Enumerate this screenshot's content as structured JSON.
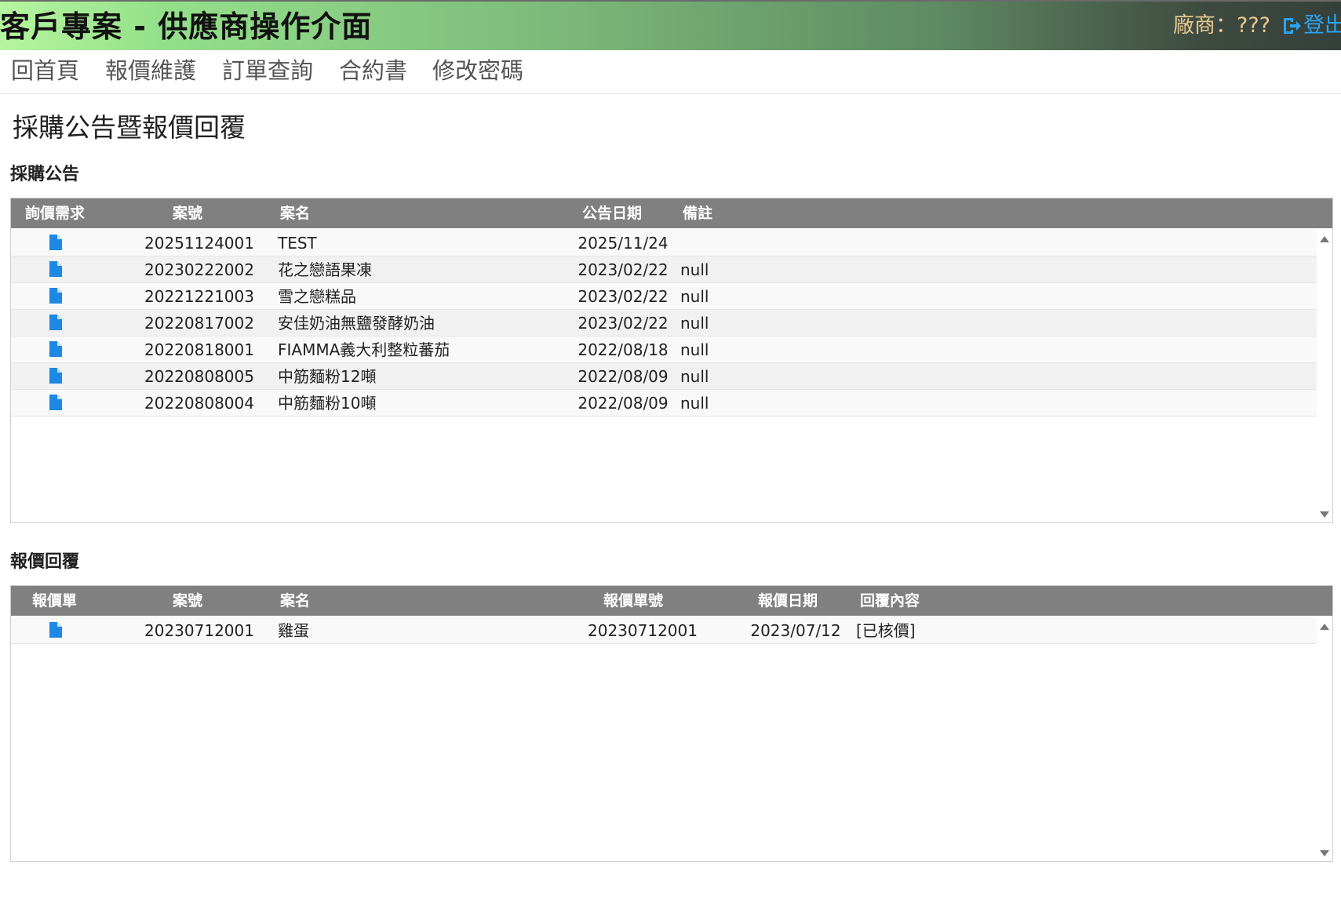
{
  "header": {
    "title": "客戶專案 - 供應商操作介面",
    "vendor_label": "廠商：???",
    "logout_label": "登出"
  },
  "nav": {
    "items": [
      {
        "label": "回首頁"
      },
      {
        "label": "報價維護"
      },
      {
        "label": "訂單查詢"
      },
      {
        "label": "合約書"
      },
      {
        "label": "修改密碼"
      }
    ]
  },
  "page": {
    "title": "採購公告暨報價回覆"
  },
  "announcements": {
    "section_title": "採購公告",
    "columns": [
      "詢價需求",
      "案號",
      "案名",
      "公告日期",
      "備註"
    ],
    "rows": [
      {
        "icon": "document-icon",
        "case_no": "20251124001",
        "case_name": "TEST",
        "date": "2025/11/24",
        "note": ""
      },
      {
        "icon": "document-icon",
        "case_no": "20230222002",
        "case_name": "花之戀語果凍",
        "date": "2023/02/22",
        "note": "null"
      },
      {
        "icon": "document-icon",
        "case_no": "20221221003",
        "case_name": "雪之戀糕品",
        "date": "2023/02/22",
        "note": "null"
      },
      {
        "icon": "document-icon",
        "case_no": "20220817002",
        "case_name": "安佳奶油無鹽發酵奶油",
        "date": "2023/02/22",
        "note": "null"
      },
      {
        "icon": "document-icon",
        "case_no": "20220818001",
        "case_name": "FIAMMA義大利整粒蕃茄",
        "date": "2022/08/18",
        "note": "null"
      },
      {
        "icon": "document-icon",
        "case_no": "20220808005",
        "case_name": "中筋麵粉12噸",
        "date": "2022/08/09",
        "note": "null"
      },
      {
        "icon": "document-icon",
        "case_no": "20220808004",
        "case_name": "中筋麵粉10噸",
        "date": "2022/08/09",
        "note": "null"
      }
    ]
  },
  "replies": {
    "section_title": "報價回覆",
    "columns": [
      "報價單",
      "案號",
      "案名",
      "報價單號",
      "報價日期",
      "回覆內容"
    ],
    "rows": [
      {
        "icon": "document-icon",
        "case_no": "20230712001",
        "case_name": "雞蛋",
        "quote_no": "20230712001",
        "quote_date": "2023/07/12",
        "reply": "[已核價]"
      }
    ]
  },
  "colors": {
    "grid_header": "#808080",
    "vendor_text": "#e7c890",
    "logout_text": "#2aa3f5",
    "doc_icon": "#1e88e5"
  }
}
